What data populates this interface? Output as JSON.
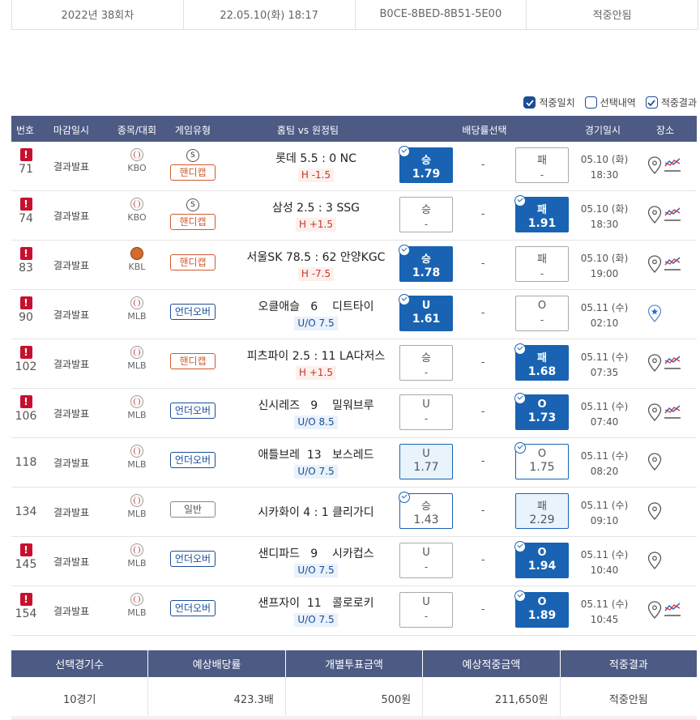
{
  "top": {
    "round": "2022년 38회차",
    "datetime": "22.05.10(화) 18:17",
    "code": "B0CE-8BED-8B51-5E00",
    "result": "적중안됨"
  },
  "legend": {
    "match": "적중일치",
    "selected": "선택내역",
    "result": "적중결과"
  },
  "headers": {
    "num": "번호",
    "deadline": "마감일시",
    "sport": "종목/대회",
    "gametype": "게임유형",
    "teams": "홈팀 vs 원정팀",
    "odds": "배당률선택",
    "gamedate": "경기일시",
    "place": "장소"
  },
  "rows": [
    {
      "warn": "!",
      "num": "71",
      "deadline": "결과발표",
      "league": "KBO",
      "sport": "baseball",
      "s": "S",
      "type": "핸디캡",
      "teams": "롯데 5.5 : 0 NC",
      "handi": "H -1.5",
      "left_top": "승",
      "left_bot": "1.79",
      "dash": "-",
      "right_top": "패",
      "right_bot": "-",
      "date": "05.10 (화)",
      "time": "18:30"
    },
    {
      "warn": "!",
      "num": "74",
      "deadline": "결과발표",
      "league": "KBO",
      "sport": "baseball",
      "s": "S",
      "type": "핸디캡",
      "teams": "삼성 2.5 : 3 SSG",
      "handi": "H +1.5",
      "left_top": "승",
      "left_bot": "-",
      "dash": "-",
      "right_top": "패",
      "right_bot": "1.91",
      "date": "05.10 (화)",
      "time": "18:30"
    },
    {
      "warn": "!",
      "num": "83",
      "deadline": "결과발표",
      "league": "KBL",
      "sport": "basketball",
      "type": "핸디캡",
      "teams": "서울SK 78.5 : 62 안양KGC",
      "handi": "H -7.5",
      "left_top": "승",
      "left_bot": "1.78",
      "dash": "-",
      "right_top": "패",
      "right_bot": "-",
      "date": "05.10 (화)",
      "time": "19:00"
    },
    {
      "warn": "!",
      "num": "90",
      "deadline": "결과발표",
      "league": "MLB",
      "sport": "baseball",
      "type": "언더오버",
      "teams": "오클애슬   6    디트타이",
      "handi": "U/O 7.5",
      "left_top": "U",
      "left_bot": "1.61",
      "dash": "-",
      "right_top": "O",
      "right_bot": "-",
      "date": "05.11 (수)",
      "time": "02:10"
    },
    {
      "warn": "!",
      "num": "102",
      "deadline": "결과발표",
      "league": "MLB",
      "sport": "baseball",
      "type": "핸디캡",
      "teams": "피츠파이 2.5 : 11 LA다저스",
      "handi": "H +1.5",
      "left_top": "승",
      "left_bot": "-",
      "dash": "-",
      "right_top": "패",
      "right_bot": "1.68",
      "date": "05.11 (수)",
      "time": "07:35"
    },
    {
      "warn": "!",
      "num": "106",
      "deadline": "결과발표",
      "league": "MLB",
      "sport": "baseball",
      "type": "언더오버",
      "teams": "신시레즈   9    밀워브루",
      "handi": "U/O 8.5",
      "left_top": "U",
      "left_bot": "-",
      "dash": "-",
      "right_top": "O",
      "right_bot": "1.73",
      "date": "05.11 (수)",
      "time": "07:40"
    },
    {
      "num": "118",
      "deadline": "결과발표",
      "league": "MLB",
      "sport": "baseball",
      "type": "언더오버",
      "teams": "애틀브레  13   보스레드",
      "handi": "U/O 7.5",
      "left_top": "U",
      "left_bot": "1.77",
      "dash": "-",
      "right_top": "O",
      "right_bot": "1.75",
      "date": "05.11 (수)",
      "time": "08:20"
    },
    {
      "num": "134",
      "deadline": "결과발표",
      "league": "MLB",
      "sport": "baseball",
      "type": "일반",
      "teams": "시카화이 4 : 1 클리가디",
      "left_top": "승",
      "left_bot": "1.43",
      "dash": "-",
      "right_top": "패",
      "right_bot": "2.29",
      "date": "05.11 (수)",
      "time": "09:10"
    },
    {
      "warn": "!",
      "num": "145",
      "deadline": "결과발표",
      "league": "MLB",
      "sport": "baseball",
      "type": "언더오버",
      "teams": "샌디파드   9    시카컵스",
      "handi": "U/O 7.5",
      "left_top": "U",
      "left_bot": "-",
      "dash": "-",
      "right_top": "O",
      "right_bot": "1.94",
      "date": "05.11 (수)",
      "time": "10:40"
    },
    {
      "warn": "!",
      "num": "154",
      "deadline": "결과발표",
      "league": "MLB",
      "sport": "baseball",
      "type": "언더오버",
      "teams": "샌프자이  11   콜로로키",
      "handi": "U/O 7.5",
      "left_top": "U",
      "left_bot": "-",
      "dash": "-",
      "right_top": "O",
      "right_bot": "1.89",
      "date": "05.11 (수)",
      "time": "10:45"
    }
  ],
  "summary": {
    "headers": [
      "선택경기수",
      "예상배당률",
      "개별투표금액",
      "예상적중금액",
      "적중결과"
    ],
    "values": [
      "10경기",
      "423.3배",
      "500원",
      "211,650원",
      "적중안됨"
    ]
  },
  "colors": {
    "header_bg": "#4c5a84",
    "selected_blue": "#1963b2",
    "warn_red": "#c8102e",
    "handicap_orange": "#cf5b2e"
  }
}
